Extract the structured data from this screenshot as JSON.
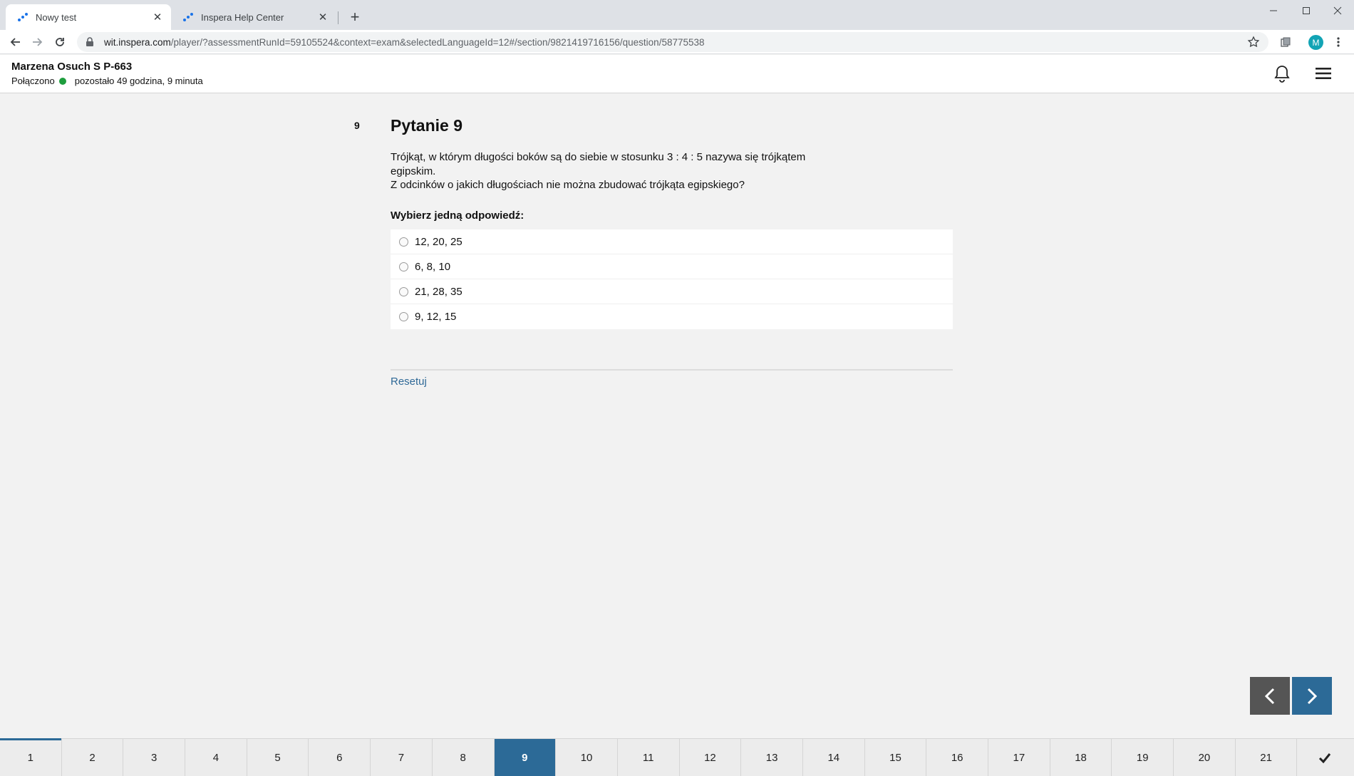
{
  "browser": {
    "tabs": [
      {
        "title": "Nowy test",
        "active": true
      },
      {
        "title": "Inspera Help Center",
        "active": false
      }
    ],
    "url_host": "wit.inspera.com",
    "url_path": "/player/?assessmentRunId=59105524&context=exam&selectedLanguageId=12#/section/9821419716156/question/58775538",
    "avatar_letter": "M"
  },
  "header": {
    "candidate": "Marzena Osuch S P-663",
    "connection": "Połączono",
    "time_left": "pozostało 49 godzina, 9 minuta",
    "colors": {
      "connected": "#1e9e3e"
    }
  },
  "question": {
    "number": "9",
    "title": "Pytanie 9",
    "text_line1": "Trójkąt, w którym długości boków są do siebie w stosunku 3 : 4 : 5 nazywa się trójkątem egipskim.",
    "text_line2": "Z odcinków o jakich długościach nie można zbudować trójkąta egipskiego?",
    "prompt": "Wybierz jedną odpowiedź:",
    "options": [
      "12, 20, 25",
      "6, 8, 10",
      "21, 28, 35",
      "9, 12, 15"
    ],
    "reset_label": "Resetuj"
  },
  "navigation": {
    "questions": [
      "1",
      "2",
      "3",
      "4",
      "5",
      "6",
      "7",
      "8",
      "9",
      "10",
      "11",
      "12",
      "13",
      "14",
      "15",
      "16",
      "17",
      "18",
      "19",
      "20",
      "21"
    ],
    "current": "9",
    "accent": "#2c6a97"
  }
}
